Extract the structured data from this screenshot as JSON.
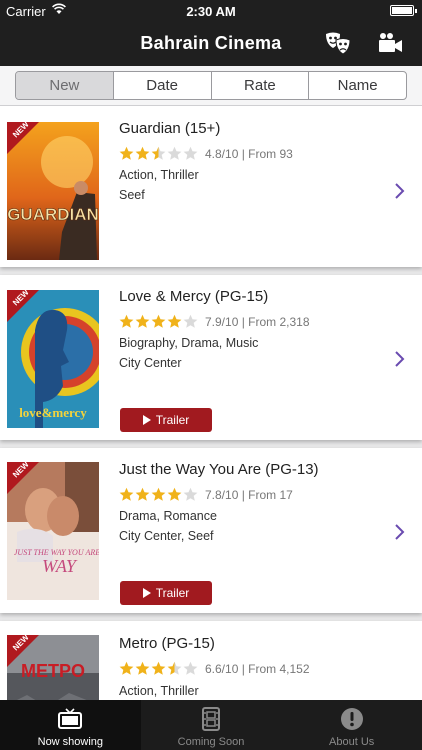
{
  "status_bar": {
    "carrier": "Carrier",
    "time": "2:30 AM"
  },
  "nav": {
    "title": "Bahrain Cinema"
  },
  "segments": [
    "New",
    "Date",
    "Rate",
    "Name"
  ],
  "colors": {
    "accent": "#a11a1f",
    "chevron": "#6a4bb0",
    "star": "#f0b21a",
    "star_empty": "#dadada"
  },
  "movies": [
    {
      "badge": "NEW",
      "poster_text": "GUARDIAN",
      "title": "Guardian (15+)",
      "stars": 2.5,
      "rating": "4.8/10 | From 93",
      "genres": "Action, Thriller",
      "location": "Seef"
    },
    {
      "badge": "NEW",
      "poster_text": "love&mercy",
      "title": "Love & Mercy (PG-15)",
      "stars": 4,
      "rating": "7.9/10 | From 2,318",
      "genres": "Biography, Drama, Music",
      "location": "City Center",
      "trailer": "Trailer"
    },
    {
      "badge": "NEW",
      "poster_text": "JUST THE WAY YOU ARE",
      "title": "Just the Way You Are (PG-13)",
      "stars": 4,
      "rating": "7.8/10 | From 17",
      "genres": "Drama, Romance",
      "location": "City Center, Seef",
      "trailer": "Trailer"
    },
    {
      "badge": "NEW",
      "poster_text": "METPO",
      "title": "Metro (PG-15)",
      "stars": 3.5,
      "rating": "6.6/10 | From 4,152",
      "genres": "Action, Thriller"
    }
  ],
  "tabs": [
    {
      "label": "Now showing",
      "icon": "tv-icon",
      "active": true
    },
    {
      "label": "Coming Soon",
      "icon": "film-icon",
      "active": false
    },
    {
      "label": "About Us",
      "icon": "info-icon",
      "active": false
    }
  ]
}
